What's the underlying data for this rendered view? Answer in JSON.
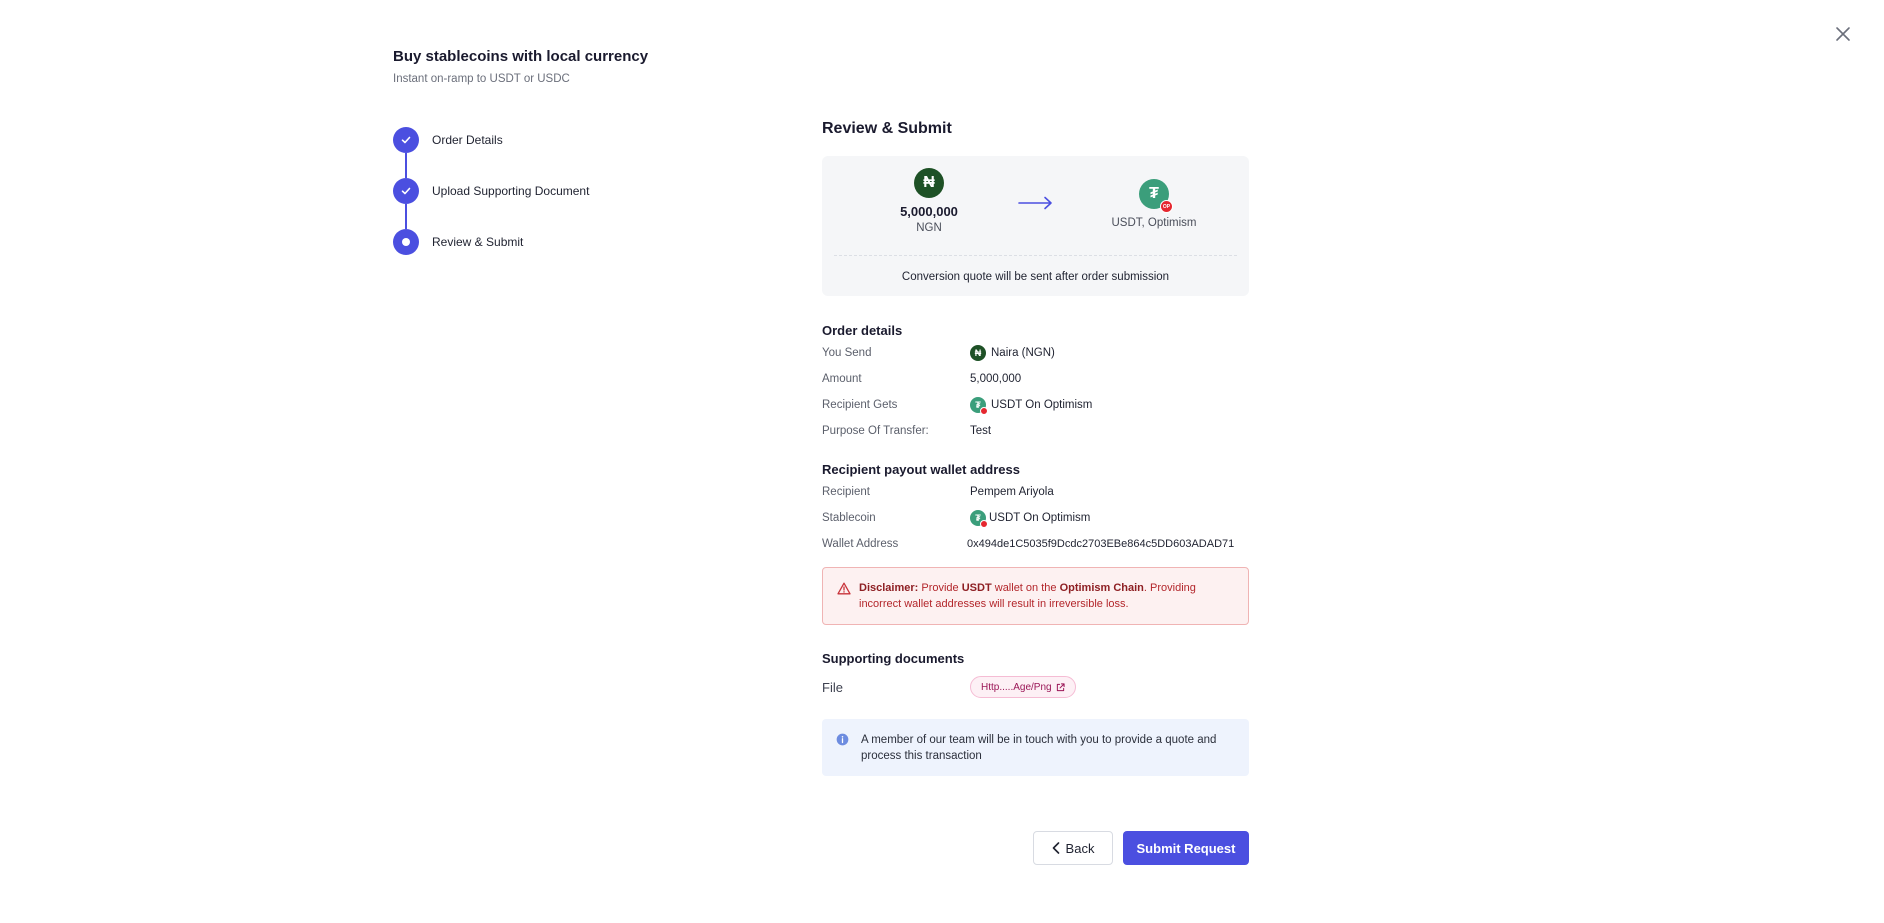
{
  "header": {
    "title": "Buy stablecoins with local currency",
    "subtitle": "Instant on-ramp to USDT or USDC"
  },
  "steps": [
    {
      "label": "Order Details",
      "state": "completed"
    },
    {
      "label": "Upload Supporting Document",
      "state": "completed"
    },
    {
      "label": "Review & Submit",
      "state": "active"
    }
  ],
  "review": {
    "title": "Review & Submit",
    "conversion": {
      "from_amount": "5,000,000",
      "from_currency": "NGN",
      "from_symbol": "₦",
      "to_label": "USDT, Optimism",
      "to_symbol": "₮",
      "network_badge": "OP",
      "note": "Conversion quote will be sent after order submission"
    },
    "order_details": {
      "title": "Order details",
      "you_send_label": "You Send",
      "you_send_value": "Naira (NGN)",
      "amount_label": "Amount",
      "amount_value": "5,000,000",
      "recipient_gets_label": "Recipient Gets",
      "recipient_gets_value": "USDT On Optimism",
      "purpose_label": "Purpose Of Transfer:",
      "purpose_value": "Test"
    },
    "payout": {
      "title": "Recipient payout wallet address",
      "recipient_label": "Recipient",
      "recipient_value": "Pempem Ariyola",
      "stablecoin_label": "Stablecoin",
      "stablecoin_value": "USDT On Optimism",
      "wallet_label": "Wallet Address",
      "wallet_value": "0x494de1C5035f9Dcdc2703EBe864c5DD603ADAD71"
    },
    "disclaimer": {
      "label": "Disclaimer:",
      "t1": " Provide ",
      "coin": "USDT",
      "t2": " wallet on the ",
      "chain": "Optimism Chain",
      "t3": ". Providing incorrect wallet addresses will result in irreversible loss."
    },
    "documents": {
      "title": "Supporting documents",
      "file_label": "File",
      "file_name": "Http.....Age/Png"
    },
    "info": "A member of our team will be in touch with you to provide a quote and process this transaction",
    "back_label": "Back",
    "submit_label": "Submit Request"
  },
  "colors": {
    "accent": "#4b4fe0",
    "naira": "#1e5126",
    "usdt": "#3b9e7b",
    "optimism": "#e5272f"
  }
}
